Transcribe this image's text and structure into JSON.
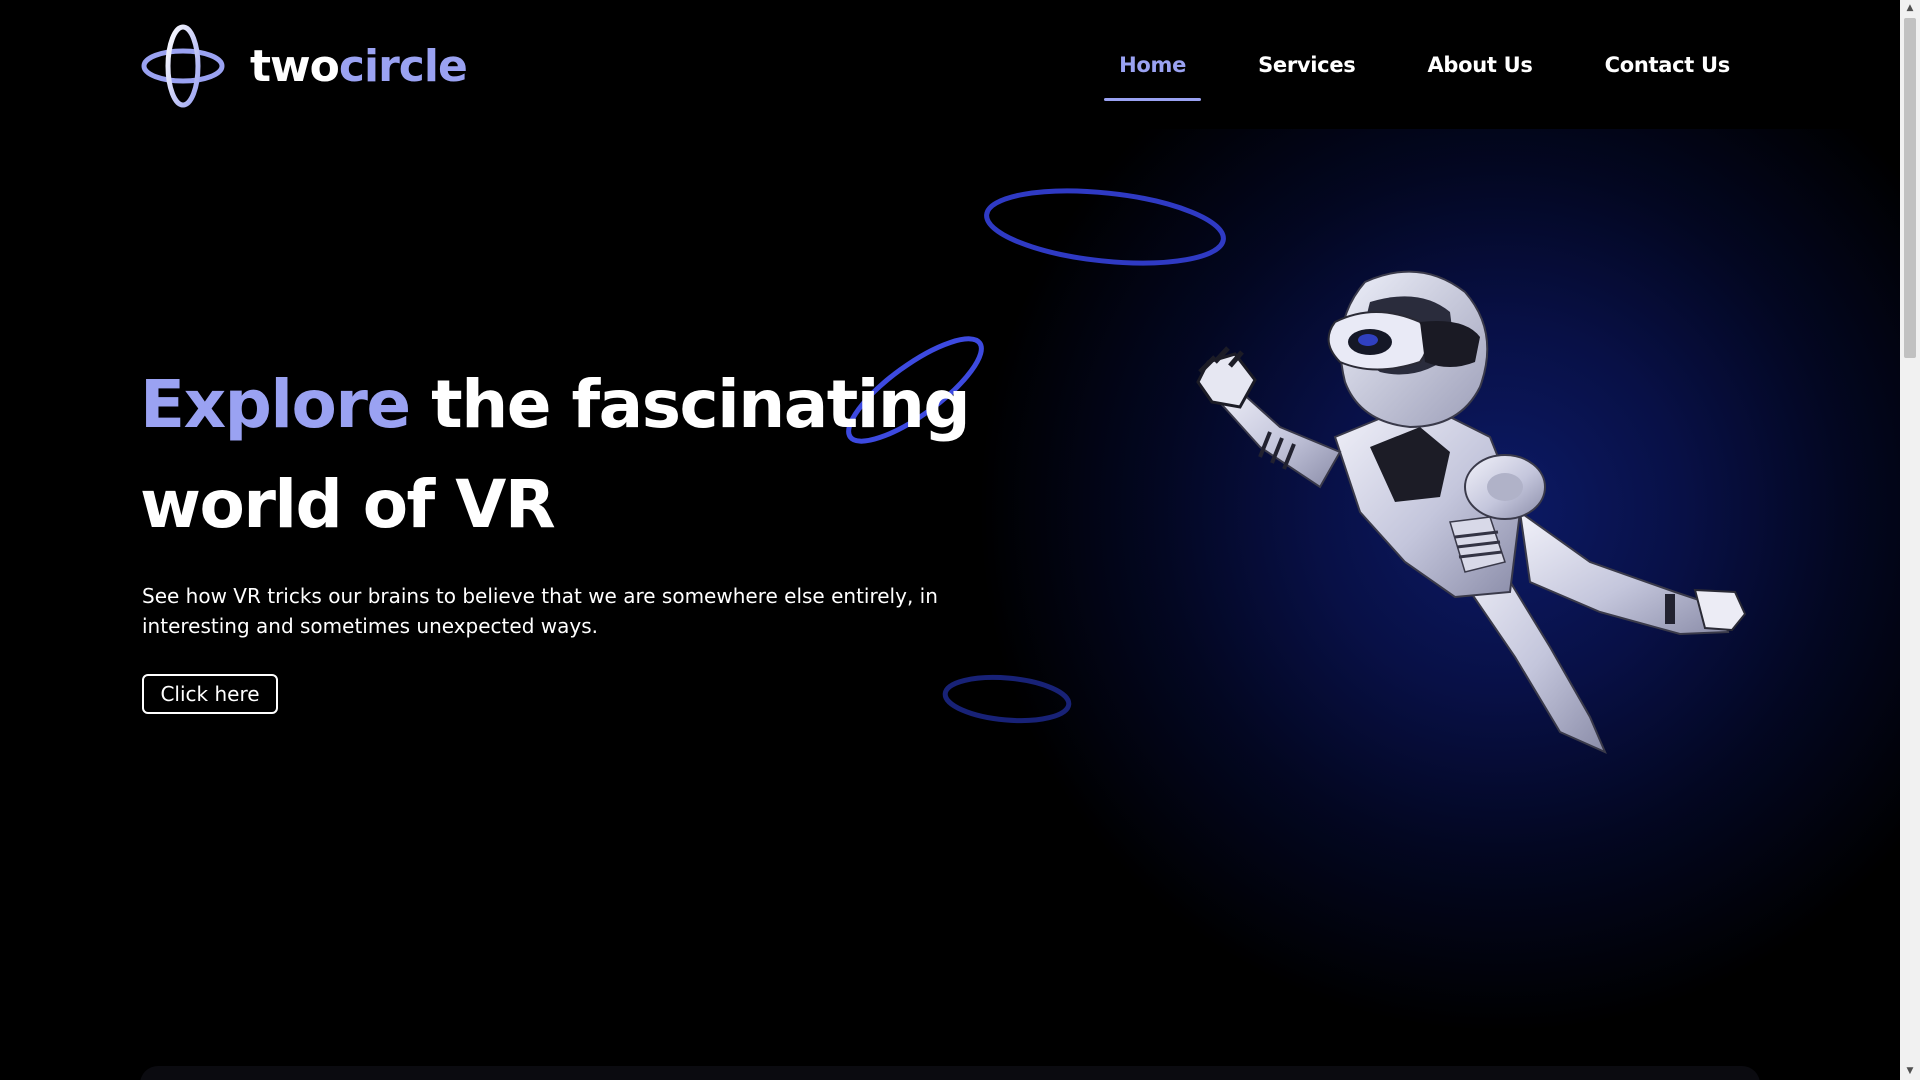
{
  "brand": {
    "name_part1": "two",
    "name_part2": "circle",
    "logo_icon": "orbit-rings-icon"
  },
  "nav": {
    "items": [
      {
        "label": "Home",
        "active": true
      },
      {
        "label": "Services",
        "active": false
      },
      {
        "label": "About Us",
        "active": false
      },
      {
        "label": "Contact Us",
        "active": false
      }
    ]
  },
  "hero": {
    "title_accent": "Explore",
    "title_line1_rest": " the fascinating",
    "title_line2": "world of VR",
    "description": "See how VR tricks our brains to believe that we are somewhere else entirely, in interesting and sometimes unexpected ways.",
    "cta_label": "Click here",
    "illustration": "flying-robot-image"
  },
  "colors": {
    "background": "#000000",
    "accent": "#9aa2f2",
    "ring_blue": "#3d4ae0",
    "text": "#ffffff"
  }
}
